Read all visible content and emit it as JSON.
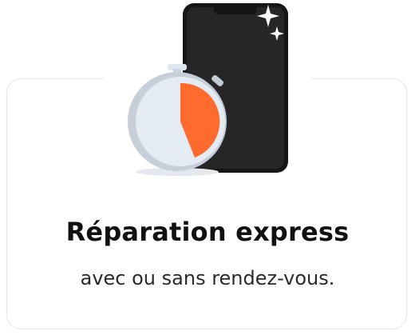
{
  "card": {
    "title": "Réparation express",
    "subtitle": "avec ou sans rendez-vous."
  },
  "illustration": {
    "icons": [
      "stopwatch-icon",
      "smartphone-icon",
      "sparkle-icon"
    ],
    "colors": {
      "accent": "#ff6b2c",
      "phone_body": "#1f1f1f",
      "phone_screen": "#262626",
      "watch_face": "#e4ebf3",
      "watch_rim": "#b9c4cf"
    }
  }
}
